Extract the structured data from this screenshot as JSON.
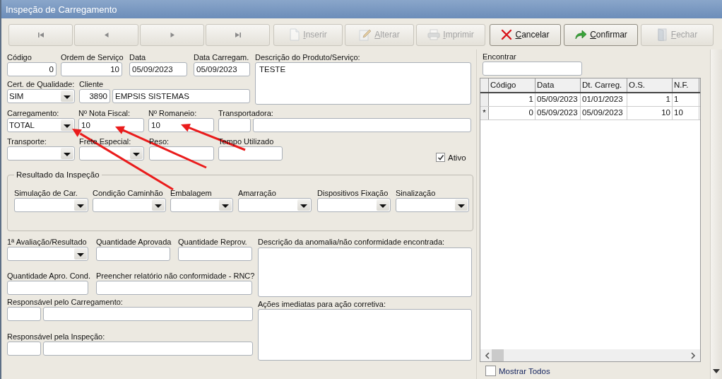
{
  "window": {
    "title": "Inspeção de Carregamento"
  },
  "nav_buttons": [
    {
      "kind": "first",
      "disabled": true
    },
    {
      "kind": "prev",
      "disabled": true
    },
    {
      "kind": "next",
      "disabled": true
    },
    {
      "kind": "last",
      "disabled": true
    }
  ],
  "action_buttons": [
    {
      "kind": "insert",
      "label": "Inserir",
      "disabled": true
    },
    {
      "kind": "edit",
      "label": "Alterar",
      "disabled": true
    },
    {
      "kind": "print",
      "label": "Imprimir",
      "disabled": true
    },
    {
      "kind": "cancel",
      "label": "Cancelar",
      "disabled": false
    },
    {
      "kind": "confirm",
      "label": "Confirmar",
      "disabled": false
    },
    {
      "kind": "close",
      "label": "Fechar",
      "disabled": true
    }
  ],
  "form": {
    "codigo": {
      "label": "Código",
      "value": "0"
    },
    "ordem_servico": {
      "label": "Ordem de Serviço",
      "value": "10"
    },
    "data": {
      "label": "Data",
      "value": "05/09/2023"
    },
    "data_carregam": {
      "label": "Data Carregam.",
      "value": "05/09/2023"
    },
    "descricao": {
      "label": "Descrição do Produto/Serviço:",
      "value": "TESTE"
    },
    "cert_qualidade": {
      "label": "Cert. de Qualidade:",
      "value": "SIM"
    },
    "cliente": {
      "label": "Cliente",
      "code": "3890",
      "name": "EMPSIS SISTEMAS"
    },
    "carregamento": {
      "label": "Carregamento:",
      "value": "TOTAL"
    },
    "nota_fiscal": {
      "label": "Nº Nota Fiscal:",
      "value": "10"
    },
    "romaneio": {
      "label": "Nº Romaneio:",
      "value": "10"
    },
    "transportadora": {
      "label": "Transportadora:"
    },
    "transporte": {
      "label": "Transporte:"
    },
    "frete_especial": {
      "label": "Frete Especial:"
    },
    "peso": {
      "label": "Peso:"
    },
    "tempo_utilizado": {
      "label": "Tempo Utilizado"
    },
    "ativo": {
      "label": "Ativo",
      "checked": true
    }
  },
  "inspection": {
    "title": "Resultado da Inspeção",
    "fields": [
      {
        "label": "Simulação de Car."
      },
      {
        "label": "Condição Caminhão"
      },
      {
        "label": "Embalagem"
      },
      {
        "label": "Amarração"
      },
      {
        "label": "Dispositivos Fixação"
      },
      {
        "label": "Sinalização"
      }
    ]
  },
  "evaluation": {
    "avaliacao": {
      "label": "1ª Avaliação/Resultado"
    },
    "qtd_aprovada": {
      "label": "Quantidade Aprovada"
    },
    "qtd_reprov": {
      "label": "Quantidade Reprov."
    },
    "qtd_apro_cond": {
      "label": "Quantidade Apro. Cond."
    },
    "rnc": {
      "label": "Preencher relatório não conformidade - RNC?"
    },
    "resp_carregamento": {
      "label": "Responsável pelo Carregamento:"
    },
    "resp_inspecao": {
      "label": "Responsável pela Inspeção:"
    },
    "anomalia": {
      "label": "Descrição da anomalia/não conformidade encontrada:"
    },
    "acoes": {
      "label": "Ações imediatas para ação corretiva:"
    }
  },
  "find": {
    "label": "Encontrar"
  },
  "grid": {
    "columns": [
      "Código",
      "Data",
      "Dt. Carreg.",
      "O.S.",
      "N.F."
    ],
    "rows": [
      {
        "cells": [
          "1",
          "05/09/2023",
          "01/01/2023",
          "1",
          "1"
        ]
      },
      {
        "marker": "*",
        "cells": [
          "0",
          "05/09/2023",
          "05/09/2023",
          "10",
          "10"
        ]
      }
    ]
  },
  "show_all": {
    "label": "Mostrar Todos",
    "checked": false
  }
}
